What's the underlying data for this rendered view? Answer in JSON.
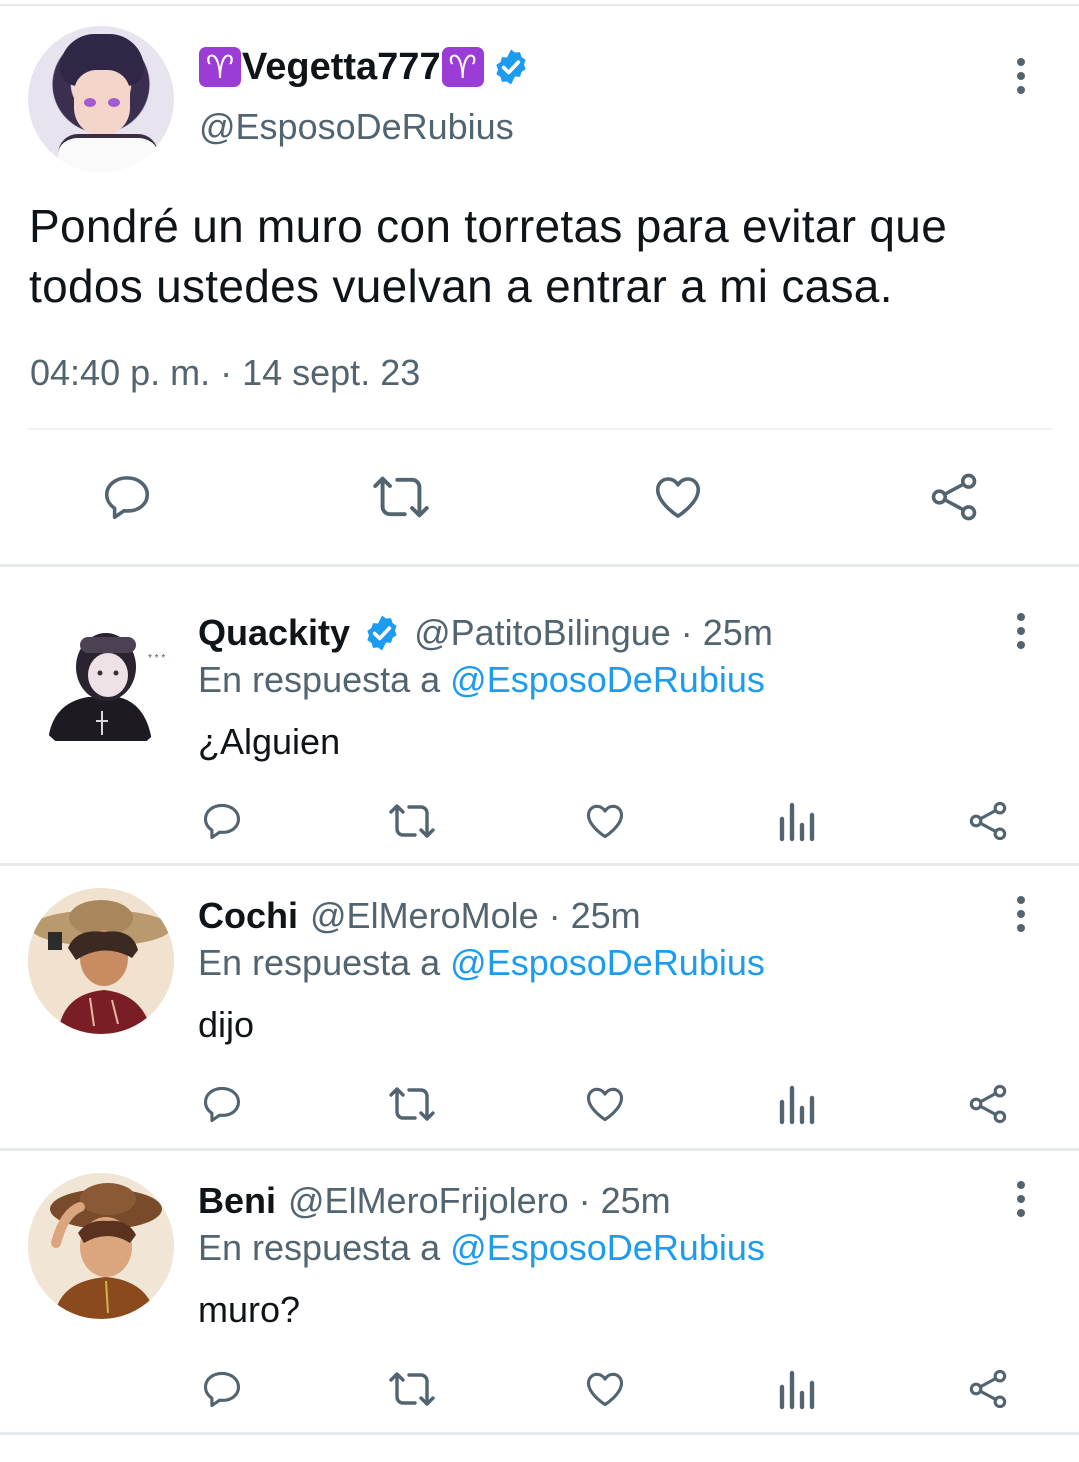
{
  "main_tweet": {
    "name_emoji": "♈",
    "name": "Vegetta777",
    "handle": "@EsposoDeRubius",
    "text": "Pondré un muro con torretas para evitar que todos ustedes vuelvan a entrar a mi casa.",
    "timestamp": "04:40 p. m. · 14 sept. 23",
    "verified": true
  },
  "replies": [
    {
      "name": "Quackity",
      "verified": true,
      "handle": "@PatitoBilingue",
      "time": "· 25m",
      "reply_prefix": "En respuesta a",
      "reply_to": "@EsposoDeRubius",
      "text": "¿Alguien"
    },
    {
      "name": "Cochi",
      "verified": false,
      "handle": "@ElMeroMole",
      "time": "· 25m",
      "reply_prefix": "En respuesta a",
      "reply_to": "@EsposoDeRubius",
      "text": "dijo"
    },
    {
      "name": "Beni",
      "verified": false,
      "handle": "@ElMeroFrijolero",
      "time": "· 25m",
      "reply_prefix": "En respuesta a",
      "reply_to": "@EsposoDeRubius",
      "text": "muro?"
    }
  ],
  "colors": {
    "text": "#0f1419",
    "secondary": "#536471",
    "link": "#1d9bf0",
    "verified": "#1d9bf0",
    "aries_badge": "#9b3cd6"
  },
  "icons": [
    "reply-icon",
    "retweet-icon",
    "like-icon",
    "views-icon",
    "share-icon",
    "more-icon",
    "verified-badge-icon"
  ]
}
